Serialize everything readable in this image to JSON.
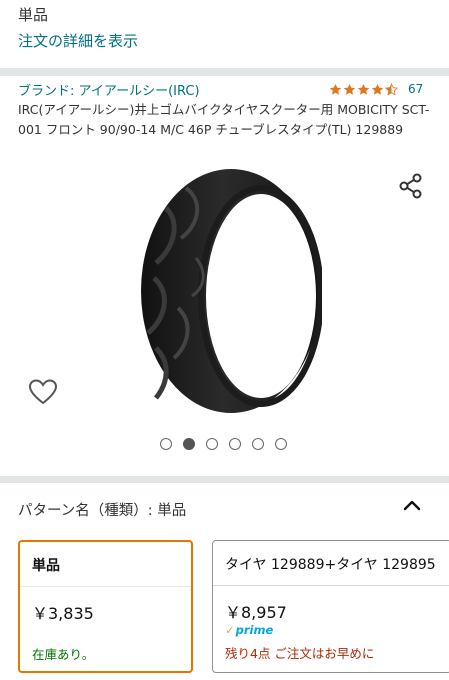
{
  "header": {
    "variant_text": "単品",
    "details_link": "注文の詳細を表示"
  },
  "product": {
    "brand": "ブランド: アイアールシー(IRC)",
    "rating_stars": 4.5,
    "rating_count": "67",
    "title": "IRC(アイアールシー)井上ゴムバイクタイヤスクーター用 MOBICITY SCT-001 フロント 90/90-14 M/C 46P チューブレスタイプ(TL) 129889",
    "image_icon": "motorcycle-tire-image"
  },
  "carousel": {
    "total": 6,
    "active_index": 1
  },
  "icons": {
    "share": "share-icon",
    "wishlist": "heart-icon",
    "collapse": "chevron-up-icon"
  },
  "pattern": {
    "label": "パターン名（種類）:  単品"
  },
  "options": [
    {
      "name": "単品",
      "price": "￥3,835",
      "stock": "在庫あり。"
    },
    {
      "name": "タイヤ 129889+タイヤ 129895",
      "price": "￥8,957",
      "prime": "prime",
      "warning": "残り4点 ご注文はお早めに"
    }
  ],
  "colors": {
    "link": "#007185",
    "selected_border": "#e77600",
    "star": "#de7921",
    "in_stock": "#007600",
    "warning": "#b12704",
    "prime": "#00a8e1"
  }
}
